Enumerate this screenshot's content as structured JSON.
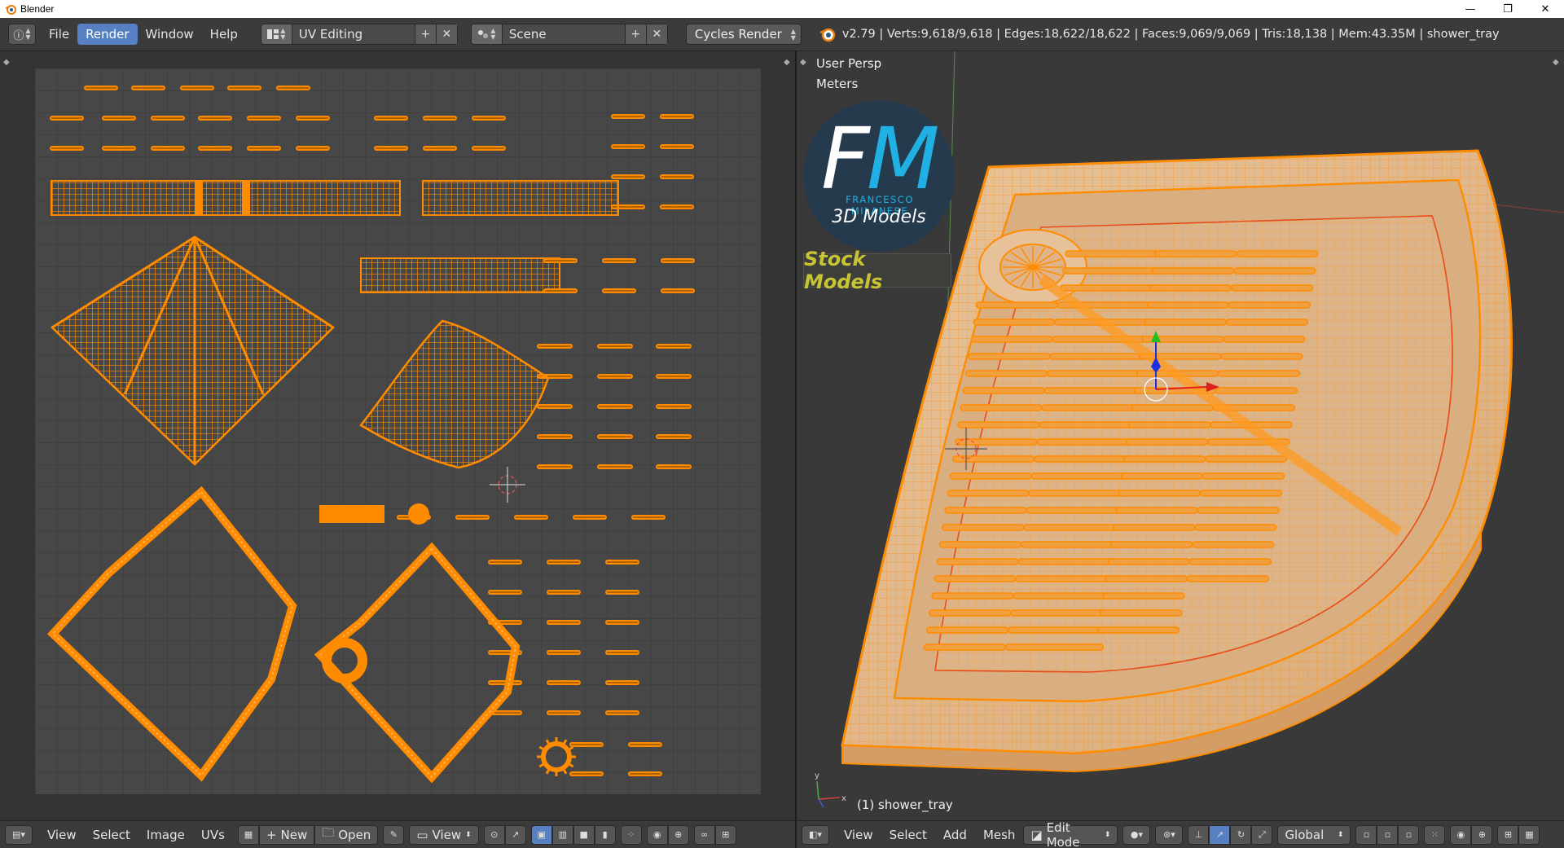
{
  "window": {
    "title": "Blender",
    "minimize": "—",
    "maximize": "❐",
    "close": "✕"
  },
  "info_header": {
    "menus": [
      {
        "label": "File",
        "active": false
      },
      {
        "label": "Render",
        "active": true
      },
      {
        "label": "Window",
        "active": false
      },
      {
        "label": "Help",
        "active": false
      }
    ],
    "screen_layout": "UV Editing",
    "scene": "Scene",
    "render_engine": "Cycles Render",
    "stats": "v2.79 | Verts:9,618/9,618 | Edges:18,622/18,622 | Faces:9,069/9,069 | Tris:18,138 | Mem:43.35M | shower_tray",
    "add_icon": "+",
    "remove_icon": "✕"
  },
  "uv_editor": {
    "footer": {
      "menus": [
        "View",
        "Select",
        "Image",
        "UVs"
      ],
      "new_label": "New",
      "open_label": "Open",
      "view_label": "View"
    }
  },
  "viewport": {
    "view_name": "User Persp",
    "units": "Meters",
    "object_label": "(1) shower_tray",
    "watermark": {
      "brand": "FRANCESCO MILANESE",
      "subtitle": "3D Models",
      "banner": "Stock Models"
    },
    "footer": {
      "menus": [
        "View",
        "Select",
        "Add",
        "Mesh"
      ],
      "mode": "Edit Mode",
      "orientation": "Global"
    }
  },
  "colors": {
    "accent": "#5680c2",
    "selection": "#ff8c00",
    "mesh_fill": "#e3b98a",
    "brand_blue": "#21b0e3",
    "banner_text": "#c9c434"
  }
}
